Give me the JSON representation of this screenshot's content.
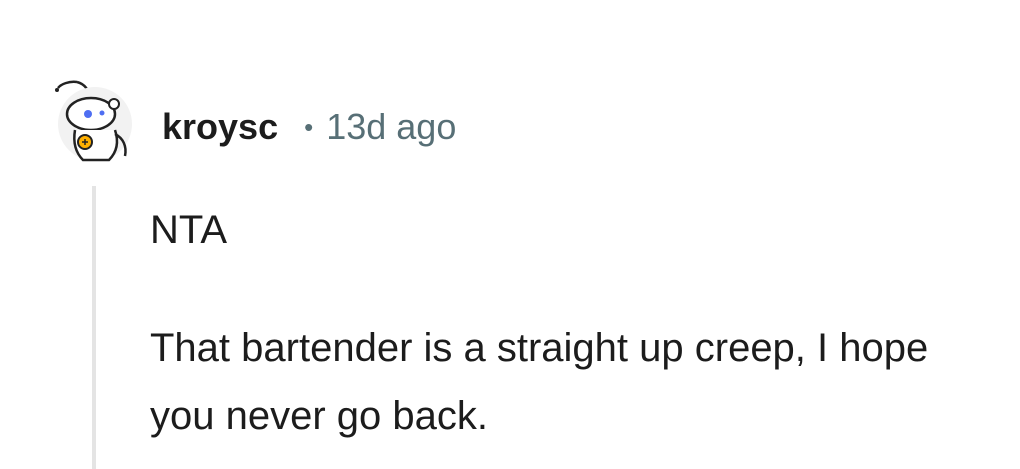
{
  "comment": {
    "author": "kroysc",
    "separator": "•",
    "timestamp": "13d ago",
    "avatar_icon": "snoo-avatar-icon",
    "body": [
      "NTA",
      "That bartender is a straight up creep, I hope you never go back."
    ]
  },
  "colors": {
    "text": "#1c1c1c",
    "meta": "#576f76",
    "thread_line": "#e4e4e4",
    "avatar_eye": "#4e6ef2",
    "avatar_accent": "#ffb000"
  }
}
